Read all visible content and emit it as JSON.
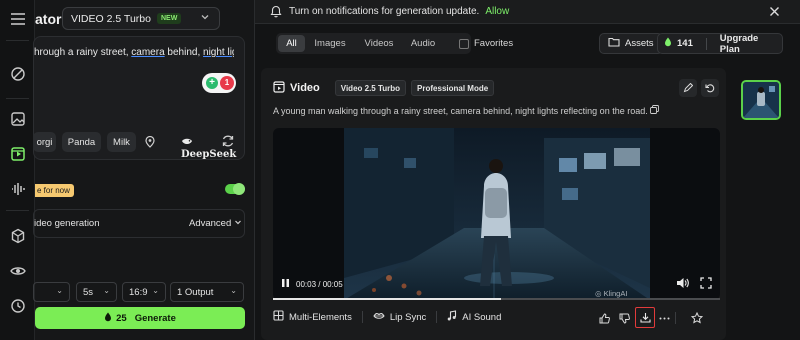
{
  "left_panel": {
    "title": "ator",
    "model": "VIDEO 2.5 Turbo",
    "model_badge": "NEW",
    "prompt_before": "hrough a rainy street, ",
    "prompt_ul1": "camera",
    "prompt_mid": " behind, ",
    "prompt_ul2": "night lights",
    "counter": "1",
    "deepseek_label": "DeepSeek",
    "chips": [
      "orgi",
      "Panda",
      "Milk"
    ],
    "promo": "e for now",
    "video_generation_label": "ideo generation",
    "advanced_label": "Advanced",
    "settings": {
      "mode": "",
      "duration": "5s",
      "aspect": "16:9",
      "outputs": "1 Output"
    },
    "generate_cost": "25",
    "generate_label": "Generate"
  },
  "notification": {
    "text": "Turn on notifications for generation update.",
    "allow": "Allow"
  },
  "filters": {
    "tabs": [
      "All",
      "Images",
      "Videos",
      "Audio"
    ],
    "active": "All",
    "favorites": "Favorites"
  },
  "header_right": {
    "assets": "Assets",
    "credits": "141",
    "upgrade": "Upgrade Plan"
  },
  "card": {
    "type_label": "Video",
    "model_tag": "Video 2.5 Turbo",
    "mode_tag": "Professional Mode",
    "prompt": "A young man walking through a rainy street, camera behind, night lights reflecting on the road.",
    "time": "00:03 / 00:05",
    "progress": 0.51,
    "watermark": "KlingAI",
    "actions": {
      "multi": "Multi-Elements",
      "lipsync": "Lip Sync",
      "sound": "AI Sound"
    }
  },
  "colors": {
    "accent": "#7bed55",
    "highlight": "#e23b3b"
  }
}
